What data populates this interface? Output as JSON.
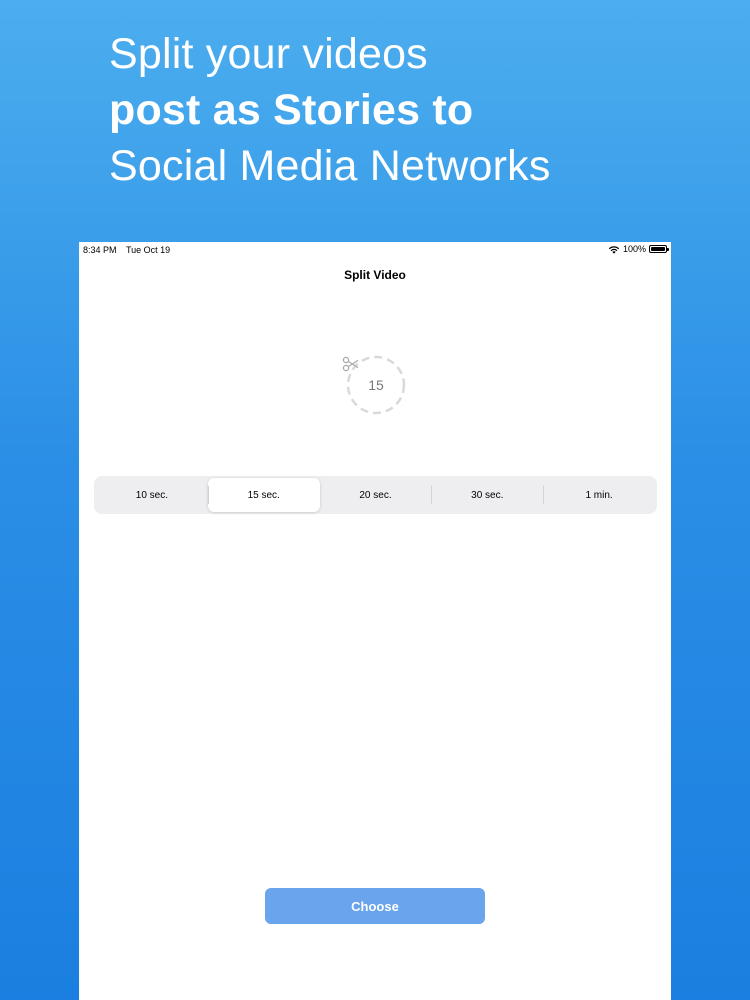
{
  "promo": {
    "line1": "Split your videos",
    "line2": "post as Stories to",
    "line3": "Social Media Networks"
  },
  "statusbar": {
    "time": "8:34 PM",
    "date": "Tue Oct 19",
    "battery": "100%",
    "icons": [
      "wifi-icon",
      "battery-icon"
    ]
  },
  "screen": {
    "title": "Split Video",
    "counter_value": "15",
    "counter_icon": "scissors-icon"
  },
  "durations": {
    "selected": "15 sec.",
    "options": [
      "10 sec.",
      "15 sec.",
      "20 sec.",
      "30 sec.",
      "1 min."
    ]
  },
  "actions": {
    "choose_label": "Choose"
  },
  "colors": {
    "background_top": "#4caeee",
    "background_bottom": "#1a7fe0",
    "button": "#69a4ec",
    "segment_bg": "#eeeef0"
  }
}
